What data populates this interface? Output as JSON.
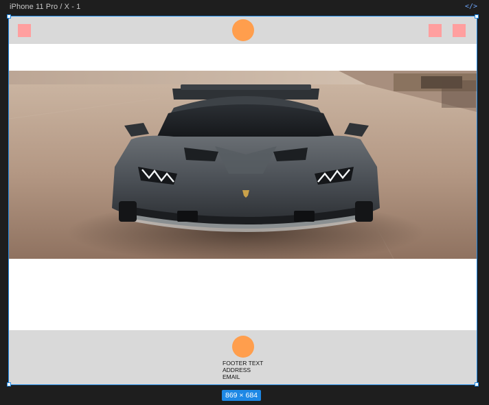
{
  "frame": {
    "label": "iPhone 11 Pro / X - 1",
    "code_icon": "code-brackets-icon",
    "size_badge": "869 × 684",
    "selection_color": "#1e88e5"
  },
  "header": {
    "background": "#d9d9d9",
    "square_color": "#ff9f9f",
    "circle_color": "#ff9e4d"
  },
  "hero": {
    "description_icon": "car-photo"
  },
  "footer": {
    "lines": [
      "FOOTER TEXT",
      "ADDRESS",
      "EMAIL"
    ],
    "circle_color": "#ff9e4d"
  }
}
